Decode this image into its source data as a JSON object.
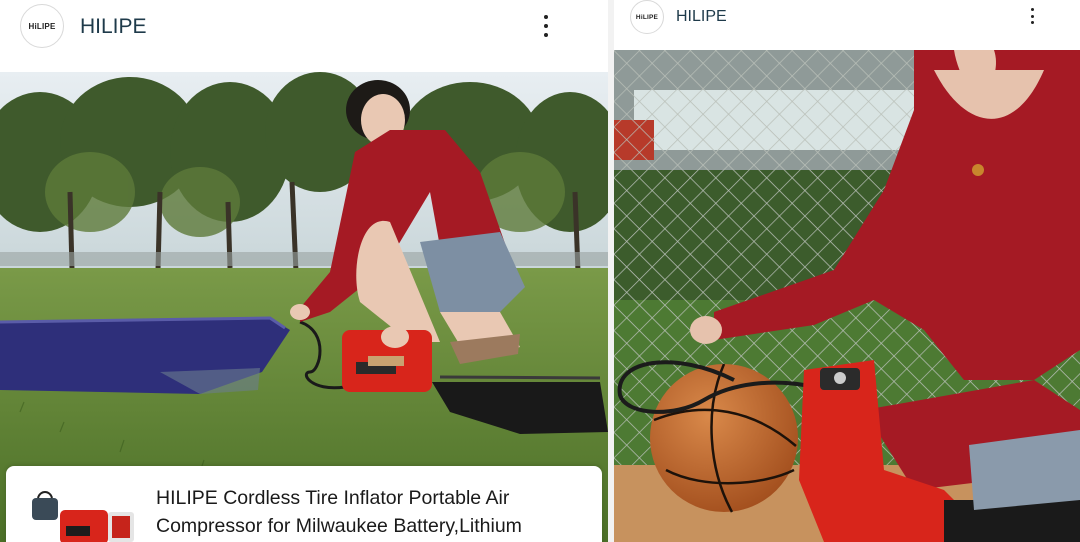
{
  "left_panel": {
    "header": {
      "logo_text": "HiLIPE",
      "brand_name": "HILIPE",
      "menu_icon": "kebab-menu-icon"
    },
    "media": {
      "share_icon": "share-icon"
    },
    "product_card": {
      "title": "HILIPE Cordless Tire Inflator Portable Air Compressor for Milwaukee Battery,Lithium"
    }
  },
  "right_panel": {
    "header": {
      "logo_text": "HiLIPE",
      "brand_name": "HILIPE",
      "menu_icon": "kebab-menu-icon"
    }
  },
  "colors": {
    "brand_text": "#1e3a4a",
    "sweater_red": "#a51a24",
    "product_red": "#d8251b",
    "grass": "#4f7a2e",
    "mattress_blue": "#2e2f7a",
    "share_button_bg": "#1e1e1e"
  }
}
